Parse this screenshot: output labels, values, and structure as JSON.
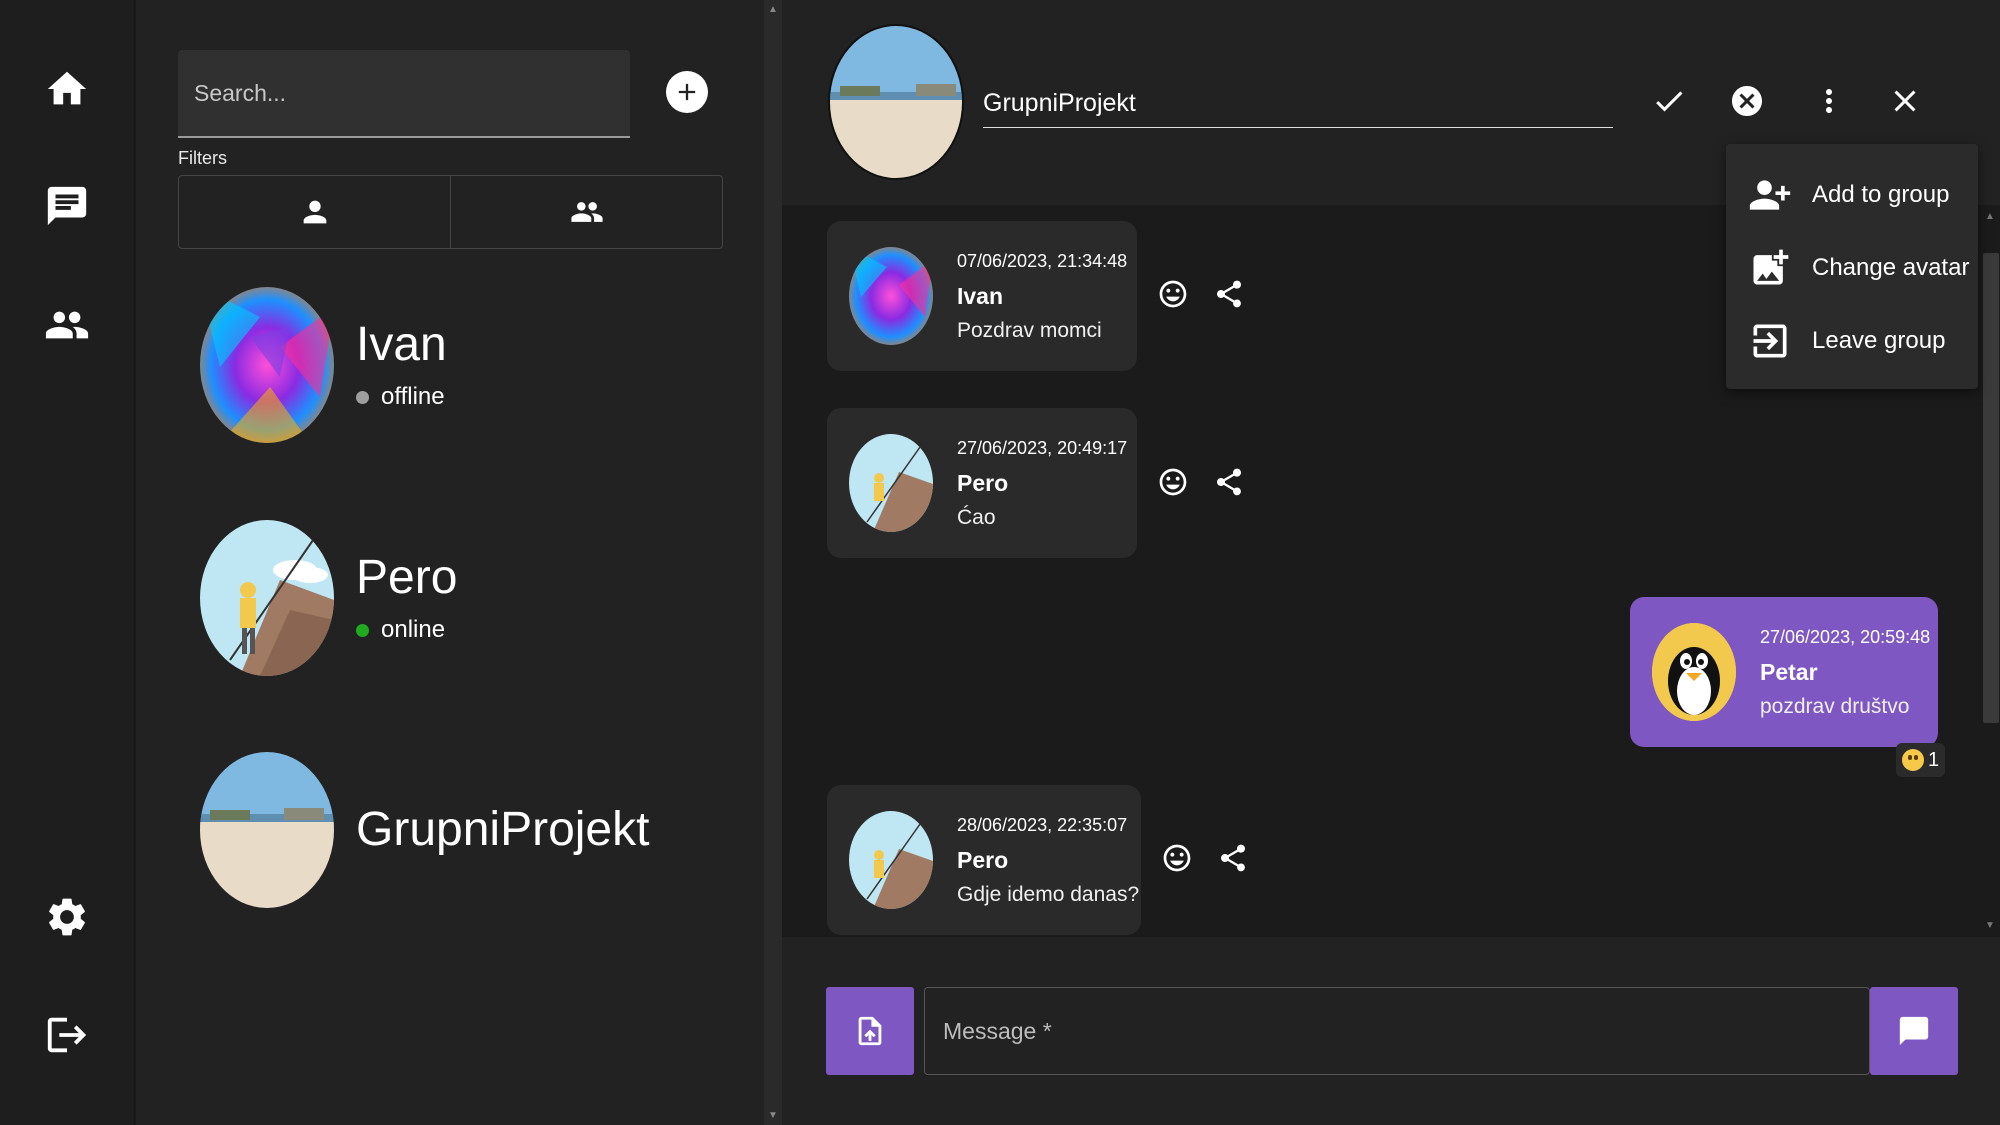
{
  "nav": {
    "items": [
      {
        "icon": "home-icon"
      },
      {
        "icon": "chat-icon"
      },
      {
        "icon": "people-icon"
      },
      {
        "icon": "settings-icon"
      },
      {
        "icon": "logout-icon"
      }
    ]
  },
  "list": {
    "search_placeholder": "Search...",
    "filters_label": "Filters",
    "contacts": [
      {
        "name": "Ivan",
        "status": "offline",
        "status_color": "#9e9e9e"
      },
      {
        "name": "Pero",
        "status": "online",
        "status_color": "#1faa1f"
      },
      {
        "name": "GrupniProjekt",
        "status": "",
        "status_color": ""
      }
    ]
  },
  "header": {
    "group_name": "GrupniProjekt"
  },
  "menu": {
    "items": [
      {
        "label": "Add to group",
        "icon": "person-add-icon"
      },
      {
        "label": "Change avatar",
        "icon": "add-photo-icon"
      },
      {
        "label": "Leave group",
        "icon": "exit-icon"
      }
    ]
  },
  "messages": [
    {
      "time": "07/06/2023, 21:34:48",
      "sender": "Ivan",
      "text": "Pozdrav momci",
      "own": false
    },
    {
      "time": "27/06/2023, 20:49:17",
      "sender": "Pero",
      "text": "Ćao",
      "own": false
    },
    {
      "time": "27/06/2023, 20:59:48",
      "sender": "Petar",
      "text": "pozdrav društvo",
      "own": true,
      "reaction_count": "1"
    },
    {
      "time": "28/06/2023, 22:35:07",
      "sender": "Pero",
      "text": "Gdje idemo danas?",
      "own": false
    }
  ],
  "composer": {
    "placeholder": "Message *"
  },
  "colors": {
    "accent": "#7e57c2",
    "background": "#1b1b1b",
    "panel": "#222222",
    "online": "#1faa1f",
    "offline": "#9e9e9e"
  }
}
